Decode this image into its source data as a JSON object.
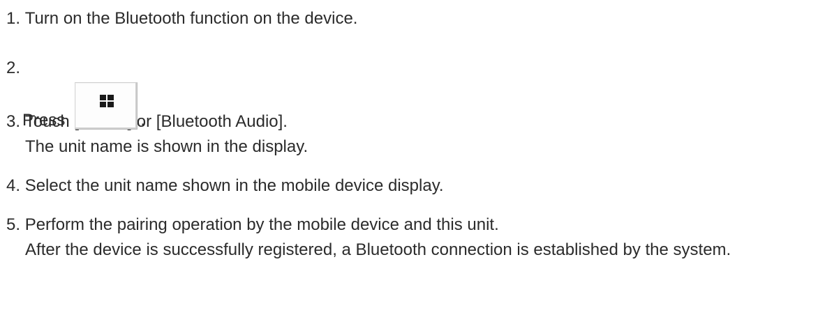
{
  "steps": [
    {
      "number": "1.",
      "text": "Turn on the Bluetooth function on the device."
    },
    {
      "number": "2.",
      "text": "Press",
      "icon": "home-grid-button-icon",
      "suffix": "."
    },
    {
      "number": "3.",
      "text": "Touch [Phone] or [Bluetooth Audio].",
      "detail": "The unit name is shown in the display."
    },
    {
      "number": "4.",
      "text": "Select the unit name shown in the mobile device display."
    },
    {
      "number": "5.",
      "text": "Perform the pairing operation by the mobile device and this unit.",
      "detail": "After the device is successfully registered, a Bluetooth connection is established by the system."
    }
  ]
}
